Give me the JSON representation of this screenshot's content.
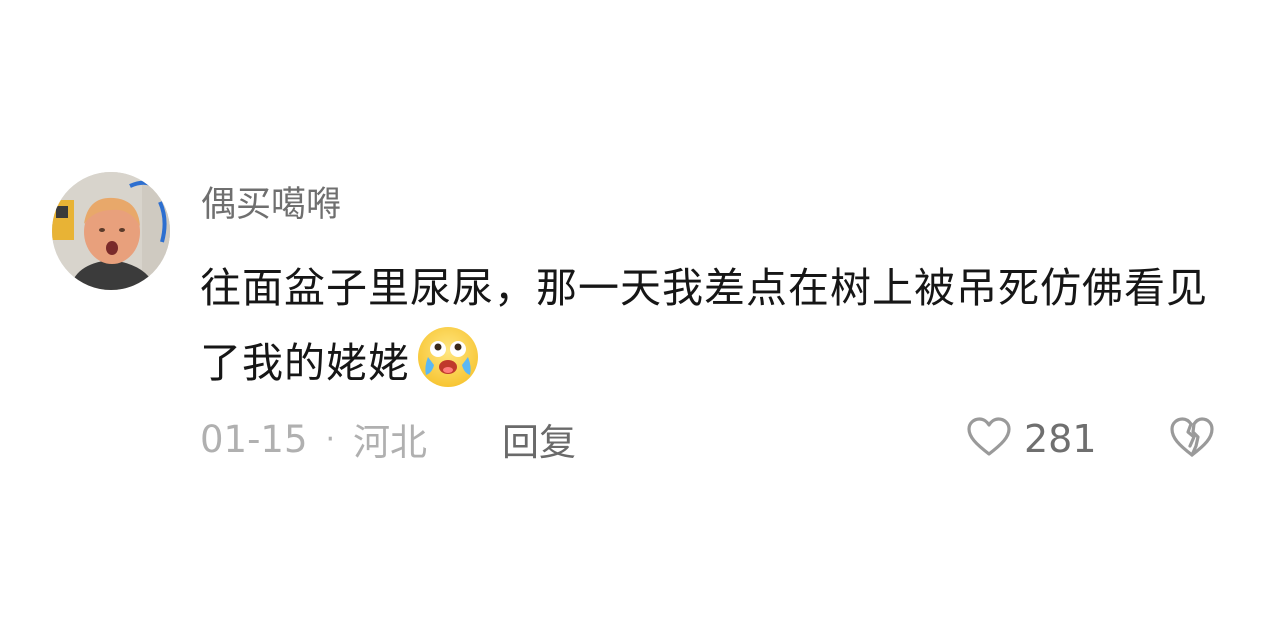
{
  "comment": {
    "username": "偶买噶嘚",
    "text": "往面盆子里尿尿，那一天我差点在树上被吊死仿佛看见了我的姥姥",
    "emoji": "laughing-crying-emoji",
    "date": "01-15",
    "separator": "·",
    "location": "河北",
    "reply_label": "回复",
    "like_count": "281"
  },
  "icons": {
    "like": "heart-outline-icon",
    "dislike": "broken-heart-icon"
  },
  "colors": {
    "username": "#6f6f6f",
    "text": "#161616",
    "meta": "#b0b0b0",
    "icon": "#9a9a9a"
  }
}
